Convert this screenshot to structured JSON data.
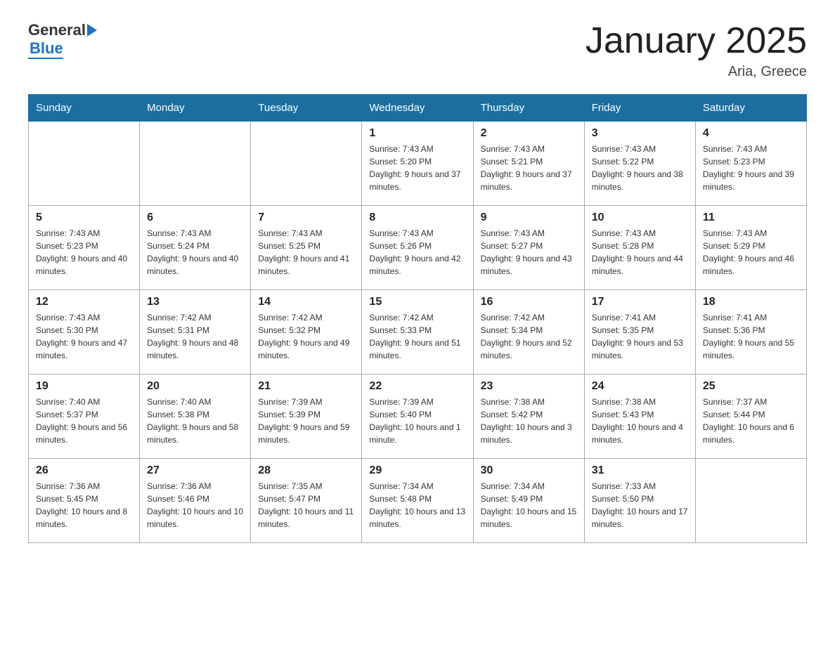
{
  "header": {
    "logo": {
      "general": "General",
      "blue": "Blue"
    },
    "title": "January 2025",
    "location": "Aria, Greece"
  },
  "weekdays": [
    "Sunday",
    "Monday",
    "Tuesday",
    "Wednesday",
    "Thursday",
    "Friday",
    "Saturday"
  ],
  "weeks": [
    [
      {
        "day": "",
        "info": ""
      },
      {
        "day": "",
        "info": ""
      },
      {
        "day": "",
        "info": ""
      },
      {
        "day": "1",
        "info": "Sunrise: 7:43 AM\nSunset: 5:20 PM\nDaylight: 9 hours and 37 minutes."
      },
      {
        "day": "2",
        "info": "Sunrise: 7:43 AM\nSunset: 5:21 PM\nDaylight: 9 hours and 37 minutes."
      },
      {
        "day": "3",
        "info": "Sunrise: 7:43 AM\nSunset: 5:22 PM\nDaylight: 9 hours and 38 minutes."
      },
      {
        "day": "4",
        "info": "Sunrise: 7:43 AM\nSunset: 5:23 PM\nDaylight: 9 hours and 39 minutes."
      }
    ],
    [
      {
        "day": "5",
        "info": "Sunrise: 7:43 AM\nSunset: 5:23 PM\nDaylight: 9 hours and 40 minutes."
      },
      {
        "day": "6",
        "info": "Sunrise: 7:43 AM\nSunset: 5:24 PM\nDaylight: 9 hours and 40 minutes."
      },
      {
        "day": "7",
        "info": "Sunrise: 7:43 AM\nSunset: 5:25 PM\nDaylight: 9 hours and 41 minutes."
      },
      {
        "day": "8",
        "info": "Sunrise: 7:43 AM\nSunset: 5:26 PM\nDaylight: 9 hours and 42 minutes."
      },
      {
        "day": "9",
        "info": "Sunrise: 7:43 AM\nSunset: 5:27 PM\nDaylight: 9 hours and 43 minutes."
      },
      {
        "day": "10",
        "info": "Sunrise: 7:43 AM\nSunset: 5:28 PM\nDaylight: 9 hours and 44 minutes."
      },
      {
        "day": "11",
        "info": "Sunrise: 7:43 AM\nSunset: 5:29 PM\nDaylight: 9 hours and 46 minutes."
      }
    ],
    [
      {
        "day": "12",
        "info": "Sunrise: 7:43 AM\nSunset: 5:30 PM\nDaylight: 9 hours and 47 minutes."
      },
      {
        "day": "13",
        "info": "Sunrise: 7:42 AM\nSunset: 5:31 PM\nDaylight: 9 hours and 48 minutes."
      },
      {
        "day": "14",
        "info": "Sunrise: 7:42 AM\nSunset: 5:32 PM\nDaylight: 9 hours and 49 minutes."
      },
      {
        "day": "15",
        "info": "Sunrise: 7:42 AM\nSunset: 5:33 PM\nDaylight: 9 hours and 51 minutes."
      },
      {
        "day": "16",
        "info": "Sunrise: 7:42 AM\nSunset: 5:34 PM\nDaylight: 9 hours and 52 minutes."
      },
      {
        "day": "17",
        "info": "Sunrise: 7:41 AM\nSunset: 5:35 PM\nDaylight: 9 hours and 53 minutes."
      },
      {
        "day": "18",
        "info": "Sunrise: 7:41 AM\nSunset: 5:36 PM\nDaylight: 9 hours and 55 minutes."
      }
    ],
    [
      {
        "day": "19",
        "info": "Sunrise: 7:40 AM\nSunset: 5:37 PM\nDaylight: 9 hours and 56 minutes."
      },
      {
        "day": "20",
        "info": "Sunrise: 7:40 AM\nSunset: 5:38 PM\nDaylight: 9 hours and 58 minutes."
      },
      {
        "day": "21",
        "info": "Sunrise: 7:39 AM\nSunset: 5:39 PM\nDaylight: 9 hours and 59 minutes."
      },
      {
        "day": "22",
        "info": "Sunrise: 7:39 AM\nSunset: 5:40 PM\nDaylight: 10 hours and 1 minute."
      },
      {
        "day": "23",
        "info": "Sunrise: 7:38 AM\nSunset: 5:42 PM\nDaylight: 10 hours and 3 minutes."
      },
      {
        "day": "24",
        "info": "Sunrise: 7:38 AM\nSunset: 5:43 PM\nDaylight: 10 hours and 4 minutes."
      },
      {
        "day": "25",
        "info": "Sunrise: 7:37 AM\nSunset: 5:44 PM\nDaylight: 10 hours and 6 minutes."
      }
    ],
    [
      {
        "day": "26",
        "info": "Sunrise: 7:36 AM\nSunset: 5:45 PM\nDaylight: 10 hours and 8 minutes."
      },
      {
        "day": "27",
        "info": "Sunrise: 7:36 AM\nSunset: 5:46 PM\nDaylight: 10 hours and 10 minutes."
      },
      {
        "day": "28",
        "info": "Sunrise: 7:35 AM\nSunset: 5:47 PM\nDaylight: 10 hours and 11 minutes."
      },
      {
        "day": "29",
        "info": "Sunrise: 7:34 AM\nSunset: 5:48 PM\nDaylight: 10 hours and 13 minutes."
      },
      {
        "day": "30",
        "info": "Sunrise: 7:34 AM\nSunset: 5:49 PM\nDaylight: 10 hours and 15 minutes."
      },
      {
        "day": "31",
        "info": "Sunrise: 7:33 AM\nSunset: 5:50 PM\nDaylight: 10 hours and 17 minutes."
      },
      {
        "day": "",
        "info": ""
      }
    ]
  ]
}
